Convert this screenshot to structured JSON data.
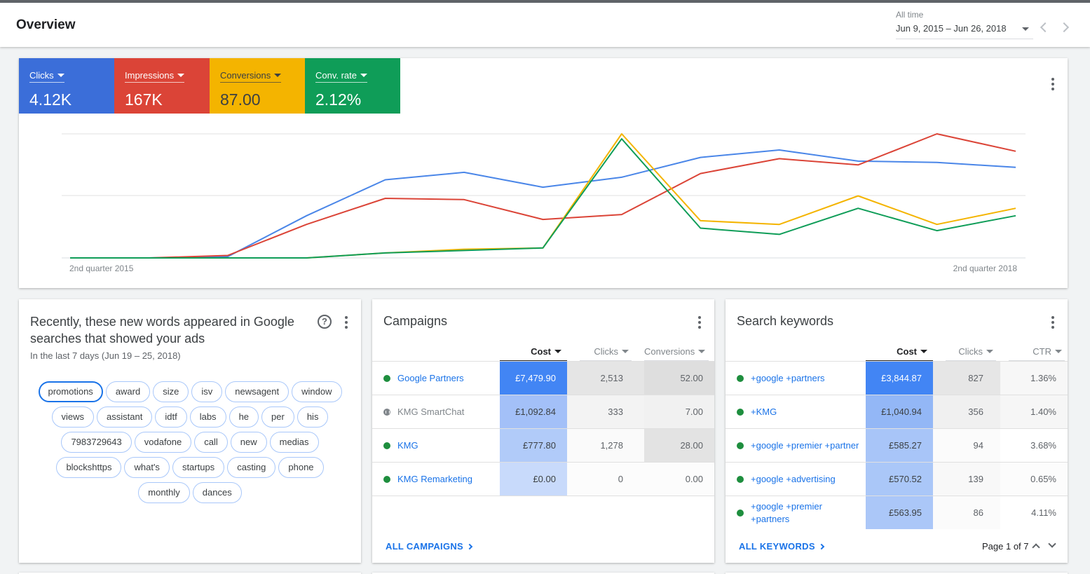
{
  "header": {
    "title": "Overview",
    "date_label": "All time",
    "date_value": "Jun 9, 2015 – Jun 26, 2018"
  },
  "metrics": [
    {
      "label": "Clicks",
      "value": "4.12K",
      "color": "#3b6ed9"
    },
    {
      "label": "Impressions",
      "value": "167K",
      "color": "#db4437"
    },
    {
      "label": "Conversions",
      "value": "87.00",
      "color": "#f4b400"
    },
    {
      "label": "Conv. rate",
      "value": "2.12%",
      "color": "#0f9d58"
    }
  ],
  "chart_data": {
    "type": "line",
    "x_ticks": [
      "2nd quarter 2015",
      "2nd quarter 2018"
    ],
    "y_range": [
      0,
      100
    ],
    "grid": true,
    "series": [
      {
        "metric": "Clicks",
        "color": "#4a86e8",
        "values": [
          0,
          0,
          1,
          34,
          63,
          69,
          57,
          65,
          81,
          87,
          78,
          77,
          73
        ]
      },
      {
        "metric": "Impressions",
        "color": "#db4437",
        "values": [
          0,
          0,
          2,
          27,
          48,
          47,
          31,
          35,
          68,
          80,
          75,
          100,
          86
        ]
      },
      {
        "metric": "Conversions",
        "color": "#f4b400",
        "values": [
          0,
          0,
          0,
          0,
          4,
          7,
          8,
          100,
          30,
          27,
          50,
          27,
          40
        ]
      },
      {
        "metric": "Conv. rate",
        "color": "#0f9d58",
        "values": [
          0,
          0,
          0,
          0,
          4,
          6,
          8,
          96,
          24,
          19,
          40,
          22,
          34
        ]
      }
    ]
  },
  "new_words": {
    "title": "Recently, these new words appeared in Google searches that showed your ads",
    "subtitle": "In the last 7 days (Jun 19 – 25, 2018)",
    "help_glyph": "?",
    "chips": [
      "promotions",
      "award",
      "size",
      "isv",
      "newsagent",
      "window",
      "views",
      "assistant",
      "idtf",
      "labs",
      "he",
      "per",
      "his",
      "7983729643",
      "vodafone",
      "call",
      "new",
      "medias",
      "blockshttps",
      "what's",
      "startups",
      "casting",
      "phone",
      "monthly",
      "dances"
    ]
  },
  "campaigns": {
    "title": "Campaigns",
    "columns": [
      "Cost",
      "Clicks",
      "Conversions"
    ],
    "rows": [
      {
        "name": "Google Partners",
        "status": "active",
        "cost": "£7,479.90",
        "clicks": "2,513",
        "conversions": "52.00"
      },
      {
        "name": "KMG SmartChat",
        "status": "paused",
        "cost": "£1,092.84",
        "clicks": "333",
        "conversions": "7.00"
      },
      {
        "name": "KMG",
        "status": "active",
        "cost": "£777.80",
        "clicks": "1,278",
        "conversions": "28.00"
      },
      {
        "name": "KMG Remarketing",
        "status": "active",
        "cost": "£0.00",
        "clicks": "0",
        "conversions": "0.00"
      }
    ],
    "footer_link": "ALL CAMPAIGNS"
  },
  "keywords": {
    "title": "Search keywords",
    "columns": [
      "Cost",
      "Clicks",
      "CTR"
    ],
    "rows": [
      {
        "name": "+google +partners",
        "cost": "£3,844.87",
        "clicks": "827",
        "ctr": "1.36%"
      },
      {
        "name": "+KMG",
        "cost": "£1,040.94",
        "clicks": "356",
        "ctr": "1.40%"
      },
      {
        "name": "+google +premier +partner",
        "cost": "£585.27",
        "clicks": "94",
        "ctr": "3.68%"
      },
      {
        "name": "+google +advertising",
        "cost": "£570.52",
        "clicks": "139",
        "ctr": "0.65%"
      },
      {
        "name": "+google +premier +partners",
        "cost": "£563.95",
        "clicks": "86",
        "ctr": "4.11%"
      }
    ],
    "footer_link": "ALL KEYWORDS",
    "pager": "Page 1 of 7"
  }
}
